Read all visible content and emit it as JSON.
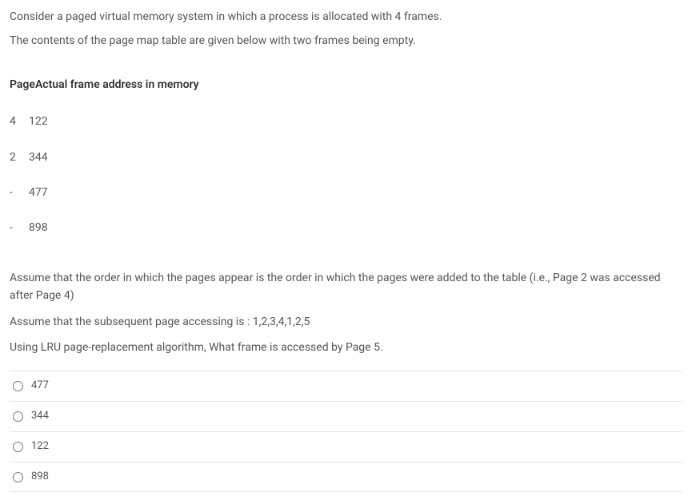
{
  "question": {
    "line1": "Consider a paged virtual memory system in which a process is allocated with 4 frames.",
    "line2": "The contents of the page map table are given below with two frames being empty."
  },
  "table": {
    "header_col1": "Page",
    "header_col2": "Actual frame address in memory",
    "rows": [
      {
        "page": "4",
        "frame": "122"
      },
      {
        "page": "2",
        "frame": "344"
      },
      {
        "page": "-",
        "frame": "477"
      },
      {
        "page": "-",
        "frame": "898"
      }
    ]
  },
  "assumptions": {
    "line1": "Assume that the order in which the pages appear is the order in which the pages were added to the table (i.e., Page 2 was accessed after Page 4)",
    "line2": "Assume that the subsequent page accessing is : 1,2,3,4,1,2,5",
    "line3": "Using LRU page-replacement algorithm, What frame is accessed by Page 5."
  },
  "options": [
    {
      "value": "477"
    },
    {
      "value": "344"
    },
    {
      "value": "122"
    },
    {
      "value": "898"
    }
  ]
}
